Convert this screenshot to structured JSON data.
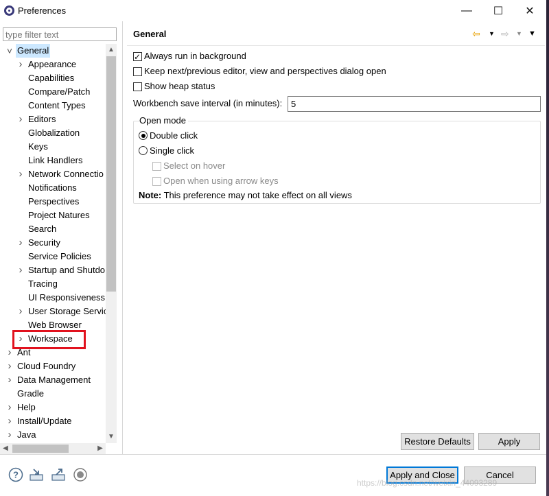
{
  "window": {
    "title": "Preferences",
    "minimize_glyph": "—",
    "maximize_glyph": "☐",
    "close_glyph": "✕"
  },
  "sidebar": {
    "filter_placeholder": "type filter text",
    "items": [
      {
        "label": "General",
        "level": 0,
        "expand": "expanded",
        "selected": true
      },
      {
        "label": "Appearance",
        "level": 1,
        "expand": "collapsed"
      },
      {
        "label": "Capabilities",
        "level": 1,
        "expand": "none"
      },
      {
        "label": "Compare/Patch",
        "level": 1,
        "expand": "none"
      },
      {
        "label": "Content Types",
        "level": 1,
        "expand": "none"
      },
      {
        "label": "Editors",
        "level": 1,
        "expand": "collapsed"
      },
      {
        "label": "Globalization",
        "level": 1,
        "expand": "none"
      },
      {
        "label": "Keys",
        "level": 1,
        "expand": "none"
      },
      {
        "label": "Link Handlers",
        "level": 1,
        "expand": "none"
      },
      {
        "label": "Network Connectio",
        "level": 1,
        "expand": "collapsed"
      },
      {
        "label": "Notifications",
        "level": 1,
        "expand": "none"
      },
      {
        "label": "Perspectives",
        "level": 1,
        "expand": "none"
      },
      {
        "label": "Project Natures",
        "level": 1,
        "expand": "none"
      },
      {
        "label": "Search",
        "level": 1,
        "expand": "none"
      },
      {
        "label": "Security",
        "level": 1,
        "expand": "collapsed"
      },
      {
        "label": "Service Policies",
        "level": 1,
        "expand": "none"
      },
      {
        "label": "Startup and Shutdo",
        "level": 1,
        "expand": "collapsed"
      },
      {
        "label": "Tracing",
        "level": 1,
        "expand": "none"
      },
      {
        "label": "UI Responsiveness",
        "level": 1,
        "expand": "none"
      },
      {
        "label": "User Storage Servic",
        "level": 1,
        "expand": "collapsed"
      },
      {
        "label": "Web Browser",
        "level": 1,
        "expand": "none"
      },
      {
        "label": "Workspace",
        "level": 1,
        "expand": "collapsed"
      },
      {
        "label": "Ant",
        "level": 0,
        "expand": "collapsed"
      },
      {
        "label": "Cloud Foundry",
        "level": 0,
        "expand": "collapsed"
      },
      {
        "label": "Data Management",
        "level": 0,
        "expand": "collapsed"
      },
      {
        "label": "Gradle",
        "level": 0,
        "expand": "none"
      },
      {
        "label": "Help",
        "level": 0,
        "expand": "collapsed"
      },
      {
        "label": "Install/Update",
        "level": 0,
        "expand": "collapsed"
      },
      {
        "label": "Java",
        "level": 0,
        "expand": "collapsed"
      }
    ],
    "highlight_color": "#e1121e"
  },
  "page": {
    "title": "General",
    "checkboxes": [
      {
        "label": "Always run in background",
        "checked": true
      },
      {
        "label": "Keep next/previous editor, view and perspectives dialog open",
        "checked": false
      },
      {
        "label": "Show heap status",
        "checked": false
      }
    ],
    "save_interval_label": "Workbench save interval (in minutes):",
    "save_interval_value": "5",
    "open_mode": {
      "title": "Open mode",
      "options": [
        {
          "label": "Double click",
          "selected": true
        },
        {
          "label": "Single click",
          "selected": false
        }
      ],
      "sub_options": [
        {
          "label": "Select on hover",
          "checked": false,
          "enabled": false
        },
        {
          "label": "Open when using arrow keys",
          "checked": false,
          "enabled": false
        }
      ],
      "note_bold": "Note:",
      "note_text": " This preference may not take effect on all views"
    },
    "restore_defaults_label": "Restore Defaults",
    "apply_label": "Apply"
  },
  "footer": {
    "apply_close_label": "Apply and Close",
    "cancel_label": "Cancel",
    "icons": [
      "help-icon",
      "import-icon",
      "export-icon",
      "record-icon"
    ],
    "watermark": "https://blog.csdn.net/weixin_44093289"
  },
  "colors": {
    "selection": "#cce8ff",
    "accent": "#0078d7",
    "nav_back": "#e8a000"
  }
}
